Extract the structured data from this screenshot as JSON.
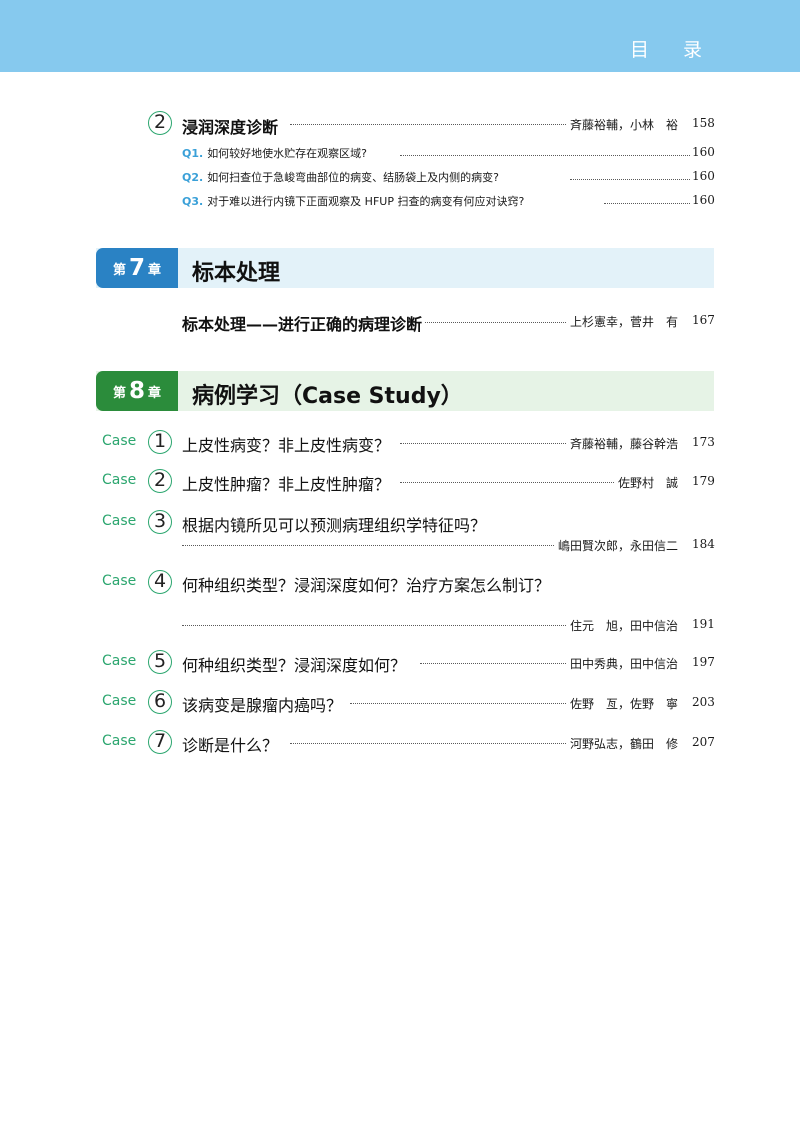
{
  "header": {
    "title": "目 录"
  },
  "section2": {
    "num": "2",
    "title": "浸润深度诊断",
    "author": "斉藤裕輔，小林　裕",
    "page": "158",
    "questions": [
      {
        "qn": "Q1.",
        "text": "如何较好地使水贮存在观察区域?",
        "page": "160"
      },
      {
        "qn": "Q2.",
        "text": "如何扫查位于急峻弯曲部位的病变、结肠袋上及内侧的病变?",
        "page": "160"
      },
      {
        "qn": "Q3.",
        "text": "对于难以进行内镜下正面观察及 HFUP 扫查的病变有何应对诀窍?",
        "page": "160"
      }
    ]
  },
  "chapter7": {
    "prefix": "第",
    "num": "7",
    "suffix": "章",
    "title": "标本处理",
    "entry": {
      "title": "标本处理——进行正确的病理诊断",
      "author": "上杉憲幸，菅井　有",
      "page": "167"
    }
  },
  "chapter8": {
    "prefix": "第",
    "num": "8",
    "suffix": "章",
    "title": "病例学习（Case Study）",
    "cases": [
      {
        "label": "Case",
        "num": "1",
        "title": "上皮性病变？非上皮性病变？",
        "author": "斉藤裕輔，藤谷幹浩",
        "page": "173"
      },
      {
        "label": "Case",
        "num": "2",
        "title": "上皮性肿瘤？非上皮性肿瘤？",
        "author": "佐野村　誠",
        "page": "179"
      },
      {
        "label": "Case",
        "num": "3",
        "title": "根据内镜所见可以预测病理组织学特征吗？",
        "author": "嶋田賢次郎，永田信二",
        "page": "184"
      },
      {
        "label": "Case",
        "num": "4",
        "title": "何种组织类型？浸润深度如何？治疗方案怎么制订？",
        "author": "住元　旭，田中信治",
        "page": "191"
      },
      {
        "label": "Case",
        "num": "5",
        "title": "何种组织类型？浸润深度如何？",
        "author": "田中秀典，田中信治",
        "page": "197"
      },
      {
        "label": "Case",
        "num": "6",
        "title": "该病变是腺瘤内癌吗？",
        "author": "佐野　亙，佐野　寧",
        "page": "203"
      },
      {
        "label": "Case",
        "num": "7",
        "title": "诊断是什么？",
        "author": "河野弘志，鶴田　修",
        "page": "207"
      }
    ]
  }
}
